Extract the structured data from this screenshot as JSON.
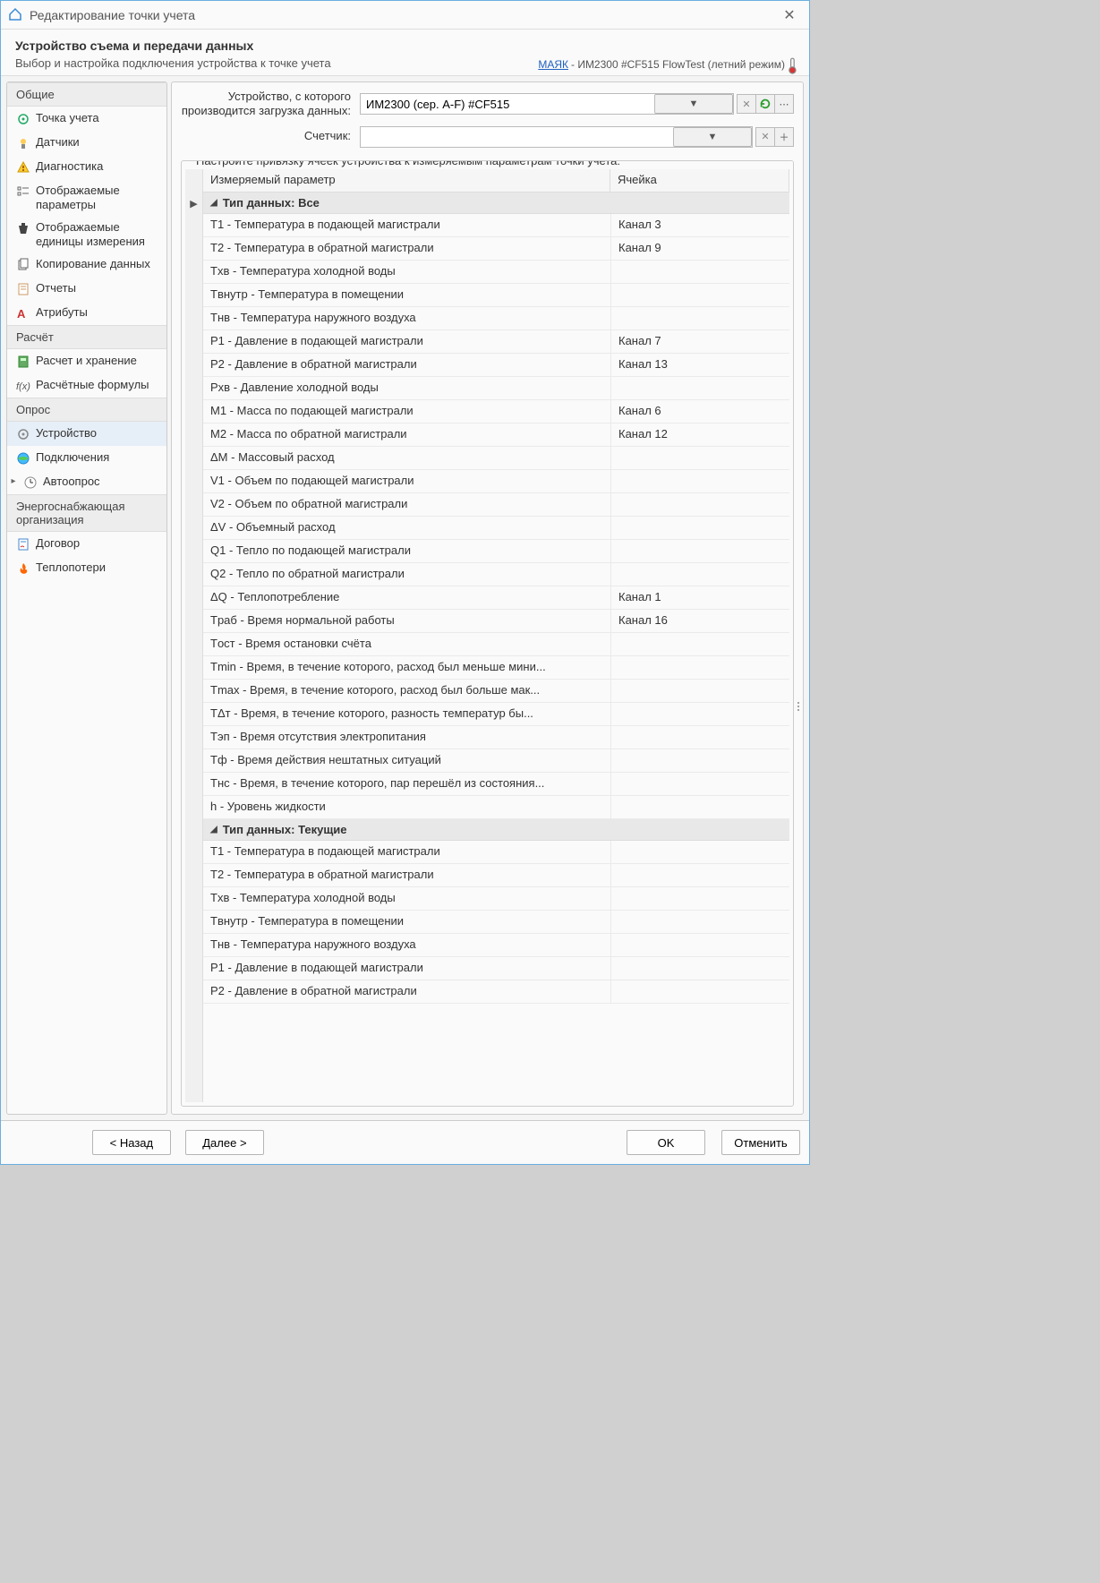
{
  "window": {
    "title": "Редактирование точки учета"
  },
  "header": {
    "title": "Устройство съема и передачи данных",
    "subtitle": "Выбор и настройка подключения устройства к точке учета",
    "link": "МАЯК",
    "device_str": " - ИМ2300 #CF515 FlowTest (летний режим)"
  },
  "sidebar": {
    "sections": [
      {
        "title": "Общие",
        "items": [
          {
            "label": "Точка учета",
            "icon": "target"
          },
          {
            "label": "Датчики",
            "icon": "sensor"
          },
          {
            "label": "Диагностика",
            "icon": "warn"
          },
          {
            "label": "Отображаемые параметры",
            "icon": "checklist"
          },
          {
            "label": "Отображаемые единицы измерения",
            "icon": "weight"
          },
          {
            "label": "Копирование данных",
            "icon": "copy"
          },
          {
            "label": "Отчеты",
            "icon": "report"
          },
          {
            "label": "Атрибуты",
            "icon": "attrs"
          }
        ]
      },
      {
        "title": "Расчёт",
        "items": [
          {
            "label": "Расчет и хранение",
            "icon": "calc"
          },
          {
            "label": "Расчётные формулы",
            "icon": "fx"
          }
        ]
      },
      {
        "title": "Опрос",
        "items": [
          {
            "label": "Устройство",
            "icon": "device",
            "selected": true
          },
          {
            "label": "Подключения",
            "icon": "globe"
          },
          {
            "label": "Автоопрос",
            "icon": "clock",
            "caret": true
          }
        ]
      },
      {
        "title": "Энергоснабжающая организация",
        "items": [
          {
            "label": "Договор",
            "icon": "contract"
          },
          {
            "label": "Теплопотери",
            "icon": "fire"
          }
        ]
      }
    ]
  },
  "form": {
    "device_label": "Устройство, с которого производится загрузка данных:",
    "device_value": "ИМ2300 (сер. A-F) #CF515",
    "counter_label": "Счетчик:",
    "counter_value": ""
  },
  "fieldset_title": "Настройте привязку ячеек устройства к измеряемым параметрам точки учета:",
  "columns": {
    "param": "Измеряемый параметр",
    "cell": "Ячейка"
  },
  "groups": [
    {
      "title": "Тип данных: Все",
      "rows": [
        {
          "p": "T1 - Температура в подающей магистрали",
          "c": "Канал 3"
        },
        {
          "p": "T2 - Температура в обратной магистрали",
          "c": "Канал 9"
        },
        {
          "p": "Tхв - Температура холодной воды",
          "c": ""
        },
        {
          "p": "Tвнутр - Температура в помещении",
          "c": ""
        },
        {
          "p": "Tнв - Температура наружного воздуха",
          "c": ""
        },
        {
          "p": "P1 - Давление в подающей магистрали",
          "c": "Канал 7"
        },
        {
          "p": "P2 - Давление в обратной магистрали",
          "c": "Канал 13"
        },
        {
          "p": "Pхв - Давление холодной воды",
          "c": ""
        },
        {
          "p": "M1 - Масса по подающей магистрали",
          "c": "Канал 6"
        },
        {
          "p": "M2 - Масса по обратной магистрали",
          "c": "Канал 12"
        },
        {
          "p": "ΔM - Массовый расход",
          "c": ""
        },
        {
          "p": "V1 - Объем по подающей магистрали",
          "c": ""
        },
        {
          "p": "V2 - Объем по обратной магистрали",
          "c": ""
        },
        {
          "p": "ΔV - Объемный расход",
          "c": ""
        },
        {
          "p": "Q1 - Тепло по подающей магистрали",
          "c": ""
        },
        {
          "p": "Q2 - Тепло по обратной магистрали",
          "c": ""
        },
        {
          "p": "ΔQ - Теплопотребление",
          "c": "Канал 1"
        },
        {
          "p": "Tраб - Время нормальной работы",
          "c": "Канал 16"
        },
        {
          "p": "Tост - Время остановки счёта",
          "c": ""
        },
        {
          "p": "Tmin - Время, в течение которого, расход был меньше мини...",
          "c": ""
        },
        {
          "p": "Tmax - Время, в течение которого, расход был больше мак...",
          "c": ""
        },
        {
          "p": "TΔт - Время, в течение которого, разность температур бы...",
          "c": ""
        },
        {
          "p": "Tэп - Время отсутствия электропитания",
          "c": ""
        },
        {
          "p": "Tф - Время действия нештатных ситуаций",
          "c": ""
        },
        {
          "p": "Tнс - Время, в течение которого, пар перешёл из состояния...",
          "c": ""
        },
        {
          "p": "h - Уровень жидкости",
          "c": ""
        }
      ]
    },
    {
      "title": "Тип данных: Текущие",
      "rows": [
        {
          "p": "T1 - Температура в подающей магистрали",
          "c": ""
        },
        {
          "p": "T2 - Температура в обратной магистрали",
          "c": ""
        },
        {
          "p": "Tхв - Температура холодной воды",
          "c": ""
        },
        {
          "p": "Tвнутр - Температура в помещении",
          "c": ""
        },
        {
          "p": "Tнв - Температура наружного воздуха",
          "c": ""
        },
        {
          "p": "P1 - Давление в подающей магистрали",
          "c": ""
        },
        {
          "p": "P2 - Давление в обратной магистрали",
          "c": ""
        }
      ]
    }
  ],
  "buttons": {
    "back": "< Назад",
    "next": "Далее >",
    "ok": "OK",
    "cancel": "Отменить"
  }
}
